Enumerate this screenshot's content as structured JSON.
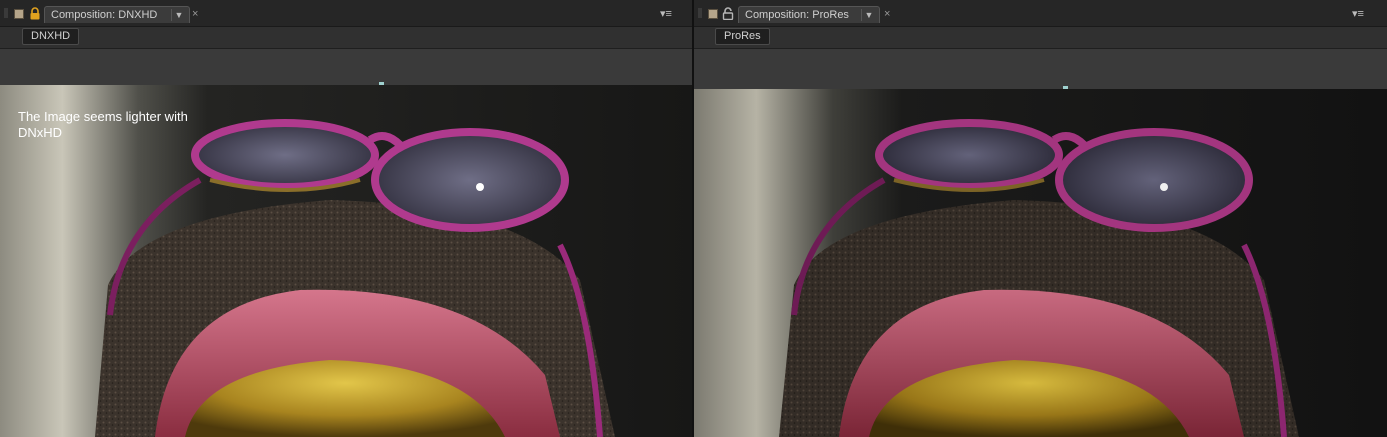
{
  "panels": [
    {
      "tab_label": "Composition: DNXHD",
      "comp_button": "DNXHD",
      "locked": true,
      "annotation": "The Image seems lighter with\nDNxHD"
    },
    {
      "tab_label": "Composition: ProRes",
      "comp_button": "ProRes",
      "locked": false,
      "annotation": ""
    }
  ],
  "icons": {
    "close": "×",
    "menu": "▾≡",
    "caret": "▼"
  },
  "colors": {
    "label_swatch": "#b5a58a",
    "lock_active": "#e1a21f",
    "lock_inactive": "#b5b5b5",
    "region_marker": "#9fd1cf"
  }
}
